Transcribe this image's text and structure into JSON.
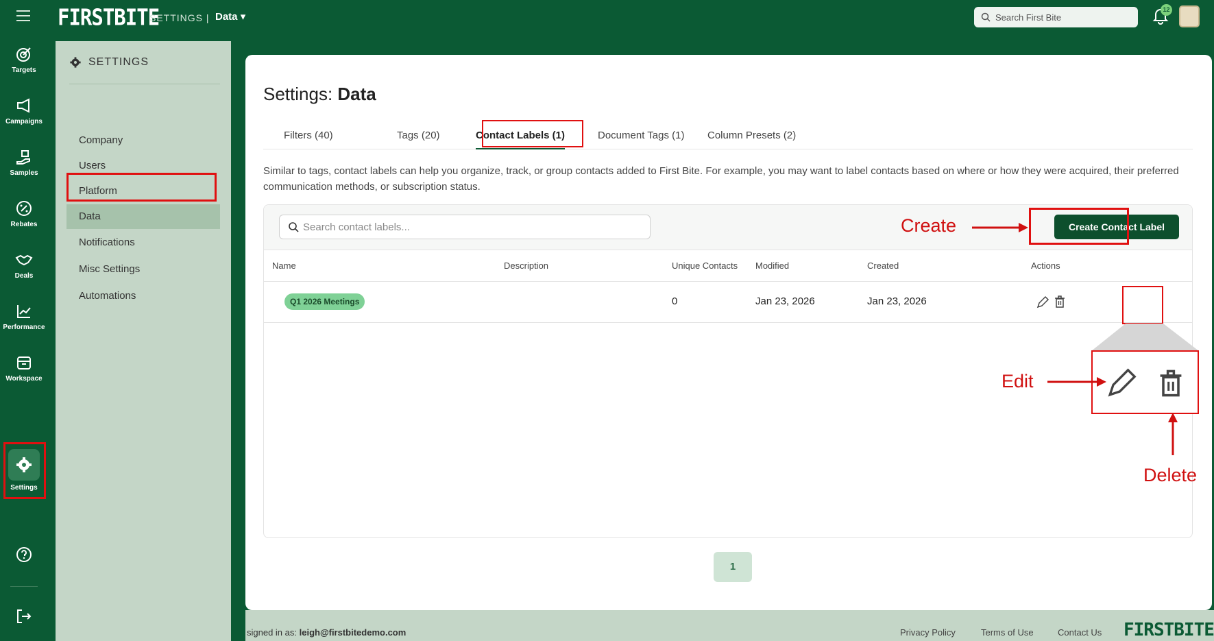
{
  "topbar": {
    "logo": "FIRSTBITE",
    "section": "SETTINGS |",
    "crumb": "Data",
    "search_placeholder": "Search First Bite",
    "notif_count": "12"
  },
  "rail": {
    "items": [
      {
        "label": "Targets"
      },
      {
        "label": "Campaigns"
      },
      {
        "label": "Samples"
      },
      {
        "label": "Rebates"
      },
      {
        "label": "Deals"
      },
      {
        "label": "Performance"
      },
      {
        "label": "Workspace"
      },
      {
        "label": "Settings"
      }
    ]
  },
  "settings_side": {
    "heading": "SETTINGS",
    "items": [
      {
        "label": "Company"
      },
      {
        "label": "Users"
      },
      {
        "label": "Platform"
      },
      {
        "label": "Data"
      },
      {
        "label": "Notifications"
      },
      {
        "label": "Misc Settings"
      },
      {
        "label": "Automations"
      }
    ]
  },
  "main": {
    "title_prefix": "Settings: ",
    "title_bold": "Data",
    "tabs": [
      {
        "label": "Filters (40)"
      },
      {
        "label": "Tags (20)"
      },
      {
        "label": "Contact Labels (1)"
      },
      {
        "label": "Document Tags (1)"
      },
      {
        "label": "Column Presets (2)"
      }
    ],
    "description": "Similar to tags, contact labels can help you organize, track, or group contacts added to First Bite. For example, you may want to label contacts based on where or how they were acquired, their preferred communication methods, or subscription status.",
    "search_placeholder": "Search contact labels...",
    "create_button": "Create Contact Label",
    "columns": [
      "Name",
      "Description",
      "Unique Contacts",
      "Modified",
      "Created",
      "Actions"
    ],
    "rows": [
      {
        "name": "Q1 2026 Meetings",
        "description": "",
        "unique_contacts": "0",
        "modified": "Jan 23, 2026",
        "created": "Jan 23, 2026"
      }
    ],
    "page": "1"
  },
  "footer": {
    "signed_prefix": "signed in as: ",
    "signed_user": "leigh@firstbitedemo.com",
    "links": [
      "Privacy Policy",
      "Terms of Use",
      "Contact Us"
    ],
    "logo": "FIRSTBITE"
  },
  "annotations": {
    "create": "Create",
    "edit": "Edit",
    "delete": "Delete"
  },
  "colors": {
    "brand_green": "#0b5a34",
    "sidebar_green": "#c4d6c7",
    "pill_green": "#7fd196",
    "annotation_red": "#e01010"
  }
}
